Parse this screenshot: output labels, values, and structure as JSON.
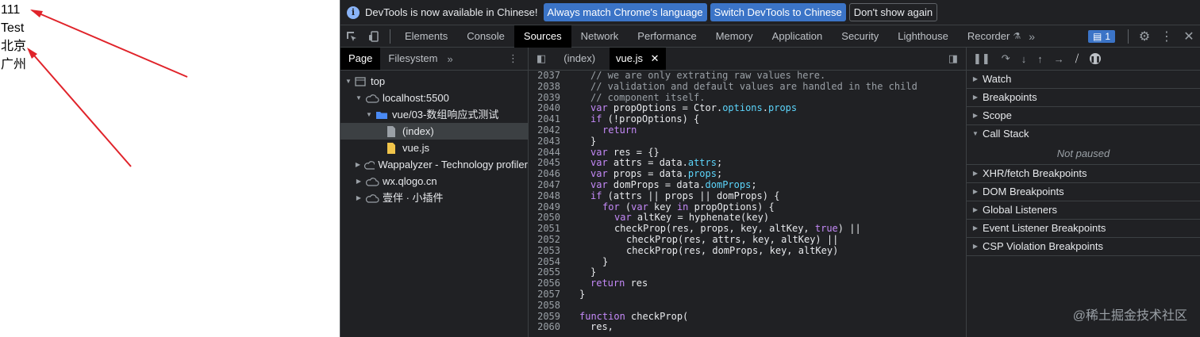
{
  "page": {
    "lines": [
      "111",
      "Test",
      "北京",
      "广州"
    ]
  },
  "devtools": {
    "infobar": {
      "text": "DevTools is now available in Chinese!",
      "btn_match": "Always match Chrome's language",
      "btn_switch": "Switch DevTools to Chinese",
      "btn_dismiss": "Don't show again"
    },
    "tabs": [
      "Elements",
      "Console",
      "Sources",
      "Network",
      "Performance",
      "Memory",
      "Application",
      "Security",
      "Lighthouse",
      "Recorder"
    ],
    "issues_count": "1",
    "navigator": {
      "tabs": [
        "Page",
        "Filesystem"
      ],
      "tree": [
        "top",
        "localhost:5500",
        "vue/03-数组响应式测试",
        "(index)",
        "vue.js",
        "Wappalyzer - Technology profiler",
        "wx.qlogo.cn",
        "壹伴 · 小插件"
      ]
    },
    "editor": {
      "tabs": [
        "(index)",
        "vue.js"
      ],
      "line_numbers": [
        "2037",
        "2038",
        "2039",
        "2040",
        "2041",
        "2042",
        "2043",
        "2044",
        "2045",
        "2046",
        "2047",
        "2048",
        "2049",
        "2050",
        "2051",
        "2052",
        "2053",
        "2054",
        "2055",
        "2056",
        "2057",
        "2058",
        "2059",
        "2060"
      ]
    },
    "debugger": {
      "sections": [
        "Watch",
        "Breakpoints",
        "Scope",
        "Call Stack",
        "XHR/fetch Breakpoints",
        "DOM Breakpoints",
        "Global Listeners",
        "Event Listener Breakpoints",
        "CSP Violation Breakpoints"
      ],
      "not_paused": "Not paused"
    },
    "watermark": "@稀土掘金技术社区"
  }
}
